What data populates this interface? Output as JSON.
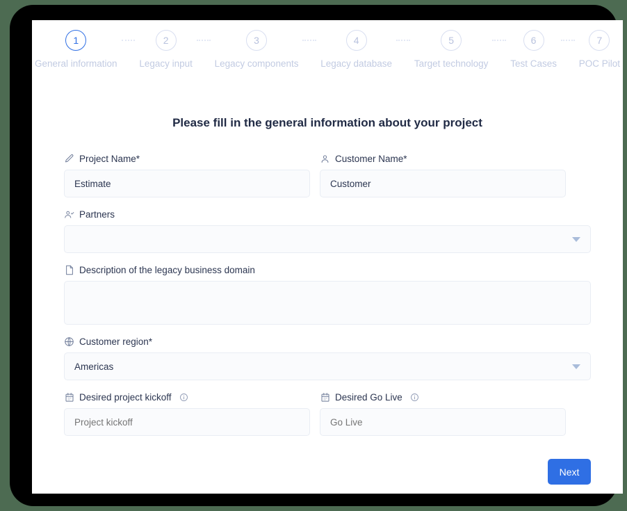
{
  "stepper": {
    "steps": [
      {
        "number": "1",
        "label": "General information",
        "active": true
      },
      {
        "number": "2",
        "label": "Legacy input",
        "active": false
      },
      {
        "number": "3",
        "label": "Legacy components",
        "active": false
      },
      {
        "number": "4",
        "label": "Legacy database",
        "active": false
      },
      {
        "number": "5",
        "label": "Target technology",
        "active": false
      },
      {
        "number": "6",
        "label": "Test Cases",
        "active": false
      },
      {
        "number": "7",
        "label": "POC Pilot",
        "active": false
      }
    ]
  },
  "form": {
    "title": "Please fill in the general information about your project",
    "project_name": {
      "label": "Project Name*",
      "icon": "pencil-icon",
      "value": "Estimate"
    },
    "customer_name": {
      "label": "Customer Name*",
      "icon": "user-icon",
      "value": "Customer"
    },
    "partners": {
      "label": "Partners",
      "icon": "user-check-icon",
      "value": ""
    },
    "description": {
      "label": "Description of the legacy business domain",
      "icon": "document-icon",
      "value": ""
    },
    "customer_region": {
      "label": "Customer region*",
      "icon": "globe-icon",
      "value": "Americas"
    },
    "project_kickoff": {
      "label": "Desired project kickoff",
      "icon": "calendar-icon",
      "info_icon": "info-icon",
      "placeholder": "Project kickoff",
      "value": ""
    },
    "go_live": {
      "label": "Desired Go Live",
      "icon": "calendar-icon",
      "info_icon": "info-icon",
      "placeholder": "Go Live",
      "value": ""
    }
  },
  "footer": {
    "next_label": "Next"
  },
  "colors": {
    "accent": "#2f6fe4",
    "page_background": "#ffffff",
    "outer_background": "#4d6b52",
    "bezel": "#000000",
    "field_background": "#fafbfd",
    "field_border": "#e9edf4",
    "muted_text": "#c2cbe2"
  }
}
